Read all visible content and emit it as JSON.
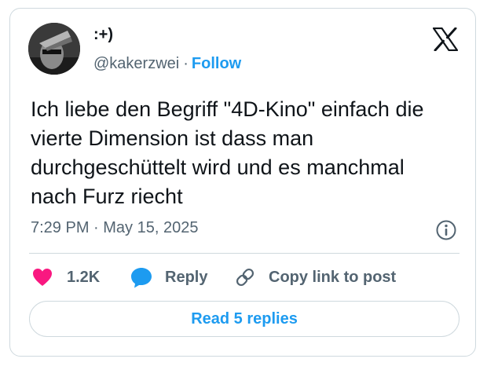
{
  "author": {
    "display_name": ":+)",
    "handle": "@kakerzwei",
    "separator": "·",
    "follow_label": "Follow"
  },
  "tweet": {
    "lines": [
      "Ich liebe den Begriff \"4D-Kino\" einfach die",
      "vierte Dimension ist dass man",
      "durchgeschüttelt wird und es manchmal",
      "nach Furz riecht"
    ],
    "timestamp": "7:29 PM · May 15, 2025"
  },
  "actions": {
    "like_count": "1.2K",
    "reply_label": "Reply",
    "copy_label": "Copy link to post"
  },
  "read_replies_label": "Read 5 replies",
  "icons": {
    "logo": "x-logo-icon",
    "info": "info-icon",
    "like": "heart-icon",
    "reply": "speech-bubble-icon",
    "copy": "link-icon"
  },
  "colors": {
    "accent": "#1d9bf0",
    "like": "#f91880",
    "text": "#0f1419",
    "secondary": "#536471",
    "border": "#cfd9de"
  }
}
